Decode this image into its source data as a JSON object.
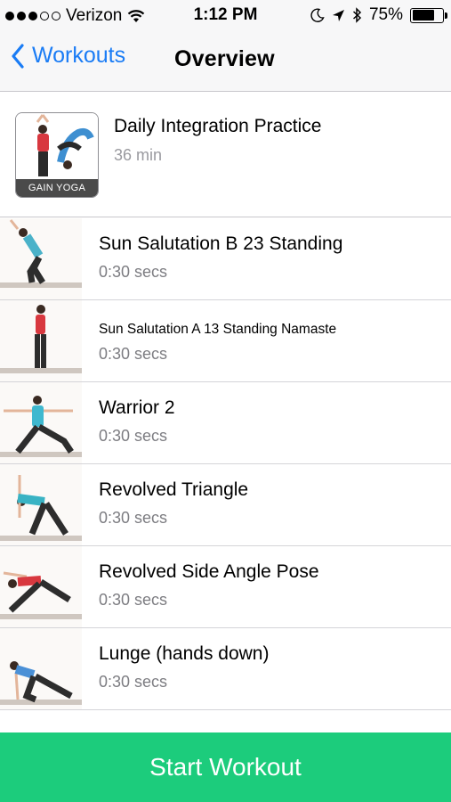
{
  "status_bar": {
    "carrier": "Verizon",
    "time": "1:12 PM",
    "battery_percent": "75%",
    "battery_level": 0.75,
    "signal_bars": 3,
    "signal_total": 5
  },
  "nav": {
    "back_label": "Workouts",
    "title": "Overview"
  },
  "program": {
    "title": "Daily Integration Practice",
    "duration": "36 min",
    "brand_label": "GAIN YOGA"
  },
  "exercises": [
    {
      "title": "Sun Salutation B 23 Standing",
      "duration": "0:30 secs",
      "small": false,
      "shirt": "#4ab2c9",
      "pants": "#2d2d2d"
    },
    {
      "title": "Sun Salutation A 13 Standing Namaste",
      "duration": "0:30 secs",
      "small": true,
      "shirt": "#d8383f",
      "pants": "#2d2d2d"
    },
    {
      "title": "Warrior 2",
      "duration": "0:30 secs",
      "small": false,
      "shirt": "#3fb8cf",
      "pants": "#2d2d2d"
    },
    {
      "title": "Revolved Triangle",
      "duration": "0:30 secs",
      "small": false,
      "shirt": "#39b3c4",
      "pants": "#2d2d2d"
    },
    {
      "title": "Revolved Side Angle Pose",
      "duration": "0:30 secs",
      "small": false,
      "shirt": "#d8383f",
      "pants": "#2d2d2d"
    },
    {
      "title": "Lunge (hands down)",
      "duration": "0:30 secs",
      "small": false,
      "shirt": "#4a90d6",
      "pants": "#2d2d2d"
    }
  ],
  "start_button": {
    "label": "Start Workout"
  },
  "colors": {
    "accent_blue": "#1a7cf5",
    "start_green": "#1ccc7c"
  }
}
